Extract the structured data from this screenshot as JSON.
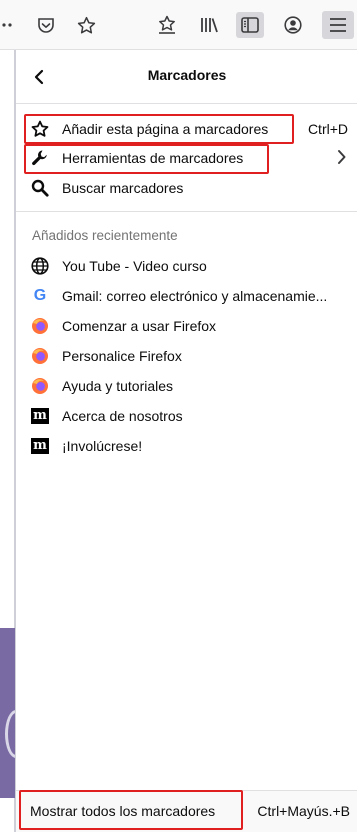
{
  "panel": {
    "title": "Marcadores"
  },
  "actions": [
    {
      "label": "Añadir esta página a marcadores",
      "shortcut": "Ctrl+D",
      "icon": "star-outline-icon"
    },
    {
      "label": "Herramientas de marcadores",
      "icon": "wrench-icon",
      "has_submenu": true
    },
    {
      "label": "Buscar marcadores",
      "icon": "search-icon"
    }
  ],
  "recent": {
    "heading": "Añadidos recientemente",
    "items": [
      {
        "label": "You Tube - Video curso",
        "icon": "globe-icon"
      },
      {
        "label": "Gmail: correo electrónico y almacenamie...",
        "icon": "google-favicon-icon"
      },
      {
        "label": "Comenzar a usar Firefox",
        "icon": "firefox-icon"
      },
      {
        "label": "Personalice Firefox",
        "icon": "firefox-icon"
      },
      {
        "label": "Ayuda y tutoriales",
        "icon": "firefox-icon"
      },
      {
        "label": "Acerca de nosotros",
        "icon": "mozilla-favicon-icon"
      },
      {
        "label": "¡Involúcrese!",
        "icon": "mozilla-favicon-icon"
      }
    ]
  },
  "favicon_glyphs": {
    "google": "G",
    "mozilla": "m"
  },
  "footer": {
    "label": "Mostrar todos los marcadores",
    "shortcut": "Ctrl+Mayús.+B"
  },
  "colors": {
    "highlight_box": "#e02020",
    "firefox_orange": "#ff7139",
    "firefox_purple": "#9059ff"
  }
}
